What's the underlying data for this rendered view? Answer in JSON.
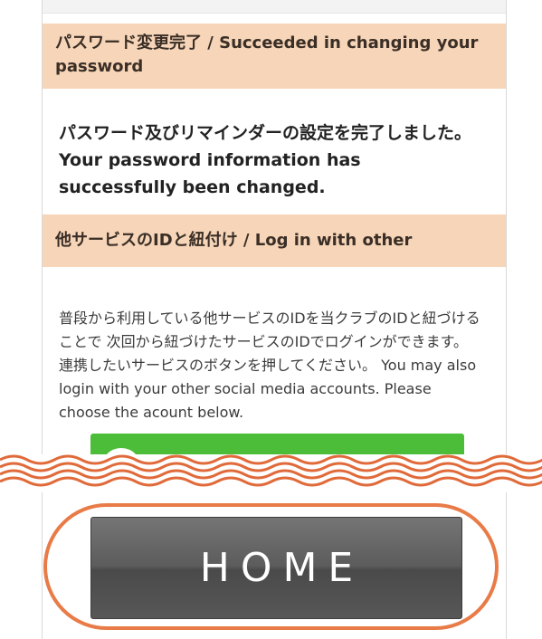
{
  "section1": {
    "title": "パスワード変更完了 / Succeeded in changing your password"
  },
  "message": "パスワード及びリマインダーの設定を完了しました。 Your password information has successfully been changed.",
  "section2": {
    "title": "他サービスのIDと紐付け / Log in with other"
  },
  "description": "普段から利用している他サービスのIDを当クラブのIDと紐づけることで 次回から紐づけたサービスのIDでログインができます。 連携したいサービスのボタンを押してください。 You may also login with your other social media accounts. Please choose the acount below.",
  "social_button": {
    "color": "#4cbd38"
  },
  "home_button": {
    "label": "HOME"
  },
  "colors": {
    "section_header": "#f6d5b8",
    "wave": "#e06a3a",
    "highlight_ring": "#e87b47"
  }
}
